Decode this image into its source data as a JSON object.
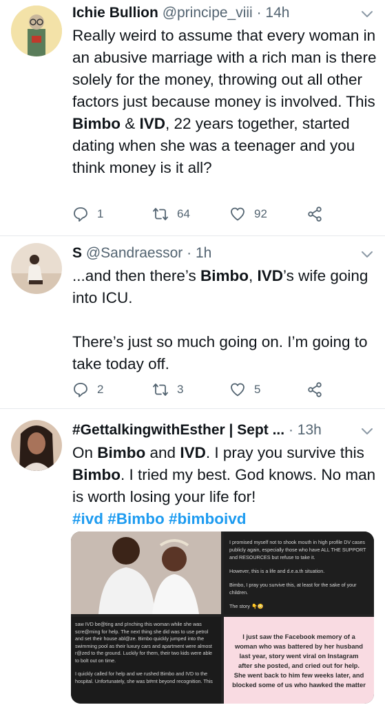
{
  "tweets": [
    {
      "name": "Ichie Bullion",
      "handle": "@principe_viii",
      "dot": "·",
      "time": "14h",
      "text_parts": [
        {
          "t": "Really weird to assume that every woman in an abusive marriage with a rich man is there solely for the money, throwing out all other factors just because money is involved. This "
        },
        {
          "b": "Bimbo"
        },
        {
          "t": " & "
        },
        {
          "b": "IVD"
        },
        {
          "t": ", 22 years together, started dating when she was a teenager and you think money is it all?"
        }
      ],
      "reply_count": "1",
      "retweet_count": "64",
      "like_count": "92"
    },
    {
      "name": "S",
      "handle": "@Sandraessor",
      "dot": "·",
      "time": "1h",
      "text_line1_a": "...and then there’s ",
      "text_line1_b": "Bimbo",
      "text_line1_c": ", ",
      "text_line1_d": "IVD",
      "text_line1_e": "’s wife going into ICU.",
      "text_para2": "There’s just so much going on. I’m going to take today off.",
      "reply_count": "2",
      "retweet_count": "3",
      "like_count": "5"
    },
    {
      "name": "#GettalkingwithEsther | Sept ...",
      "dot": "·",
      "time": "13h",
      "p1": "On ",
      "p2": "Bimbo",
      "p3": " and ",
      "p4": "IVD",
      "p5": ". I pray you survive this ",
      "p6": "Bimbo",
      "p7": ". I tried my best. God knows. No man is worth losing your life for!",
      "hashtags": "#ivd #Bimbo #bimboivd",
      "media": {
        "top_right_p1": "I promised myself not to shook mouth in high profile DV cases publicly again, especially those who have ALL THE SUPPORT and RESOURCES but refuse to take it.",
        "top_right_p2": "However, this is a life and d.e.a.th situation.",
        "top_right_p3": "Bimbo, I pray you survive this, at least for the sake of your children.",
        "top_right_p4": "The story 👇😳",
        "bottom_left_p1": "saw IVD be@ting and p!nching this woman while she was scre@ming for help. The next thing she did was to use petrol and set their house abl@ze. Bimbo quickly jumped into the swimming pool as their luxury cars and apartment were almost r@zed to the ground. Luckily for them, their two kids were able to bolt out on time.",
        "bottom_left_p2": "I quickly called for help and we rushed Bimbo and IVD to the hospital. Unfortunately, she was b#rnt beyond recognition. This",
        "bottom_right": "I just saw the Facebook memory of a woman who was battered by her husband last year, story went viral on Instagram after she posted, and cried out for help. She went back to him few weeks later, and blocked some of us who hawked the matter"
      }
    }
  ],
  "icons": [
    "reply-icon",
    "retweet-icon",
    "like-icon",
    "share-icon",
    "caret-down-icon"
  ],
  "colors": {
    "accent": "#1d9bf0",
    "muted": "#536471",
    "text": "#0f1419",
    "divider": "#e6e9ec"
  }
}
